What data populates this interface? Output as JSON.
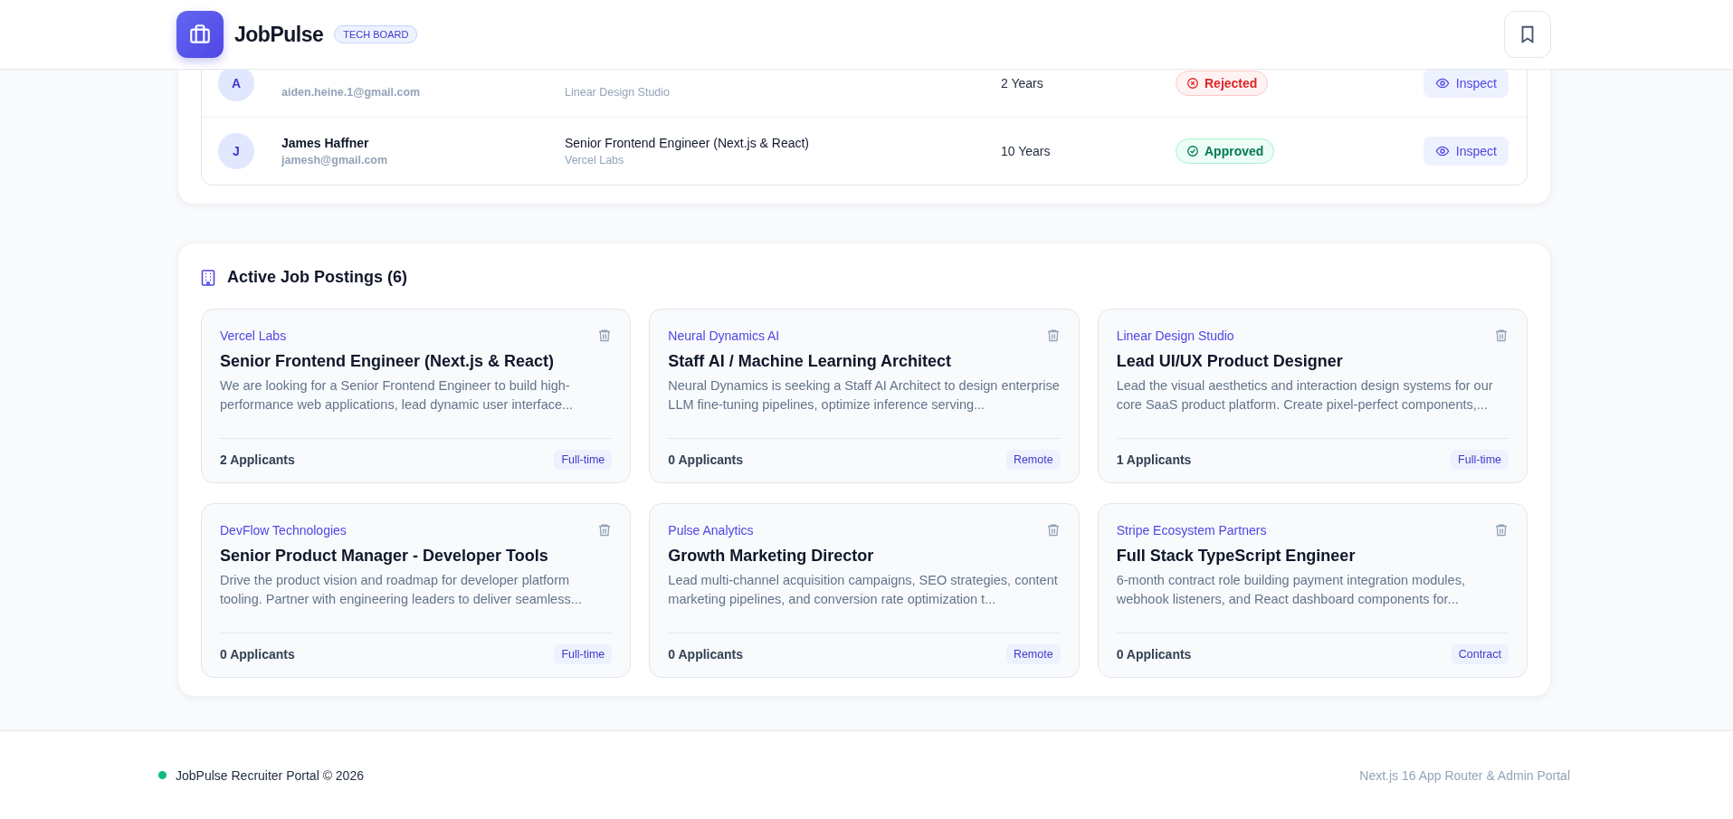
{
  "header": {
    "brand": "JobPulse",
    "badge": "TECH BOARD"
  },
  "applications": {
    "rows": [
      {
        "avatar": "A",
        "email": "aiden.heine.1@gmail.com",
        "company": "Linear Design Studio",
        "experience": "2 Years",
        "status": {
          "kind": "rejected",
          "label": "Rejected"
        },
        "action": "Inspect"
      },
      {
        "avatar": "J",
        "name": "James Haffner",
        "email": "jamesh@gmail.com",
        "job": "Senior Frontend Engineer (Next.js & React)",
        "company": "Vercel Labs",
        "experience": "10 Years",
        "status": {
          "kind": "approved",
          "label": "Approved"
        },
        "action": "Inspect"
      }
    ]
  },
  "postings": {
    "title": "Active Job Postings (6)",
    "jobs": [
      {
        "company": "Vercel Labs",
        "title": "Senior Frontend Engineer (Next.js & React)",
        "description": "We are looking for a Senior Frontend Engineer to build high-performance web applications, lead dynamic user interface...",
        "applicants": "2 Applicants",
        "type": "Full-time"
      },
      {
        "company": "Neural Dynamics AI",
        "title": "Staff AI / Machine Learning Architect",
        "description": "Neural Dynamics is seeking a Staff AI Architect to design enterprise LLM fine-tuning pipelines, optimize inference serving...",
        "applicants": "0 Applicants",
        "type": "Remote"
      },
      {
        "company": "Linear Design Studio",
        "title": "Lead UI/UX Product Designer",
        "description": "Lead the visual aesthetics and interaction design systems for our core SaaS product platform. Create pixel-perfect components,...",
        "applicants": "1 Applicants",
        "type": "Full-time"
      },
      {
        "company": "DevFlow Technologies",
        "title": "Senior Product Manager - Developer Tools",
        "description": "Drive the product vision and roadmap for developer platform tooling. Partner with engineering leaders to deliver seamless...",
        "applicants": "0 Applicants",
        "type": "Full-time"
      },
      {
        "company": "Pulse Analytics",
        "title": "Growth Marketing Director",
        "description": "Lead multi-channel acquisition campaigns, SEO strategies, content marketing pipelines, and conversion rate optimization t...",
        "applicants": "0 Applicants",
        "type": "Remote"
      },
      {
        "company": "Stripe Ecosystem Partners",
        "title": "Full Stack TypeScript Engineer",
        "description": "6-month contract role building payment integration modules, webhook listeners, and React dashboard components for...",
        "applicants": "0 Applicants",
        "type": "Contract"
      }
    ]
  },
  "footer": {
    "left": "JobPulse Recruiter Portal © 2026",
    "right": "Next.js 16 App Router & Admin Portal"
  }
}
